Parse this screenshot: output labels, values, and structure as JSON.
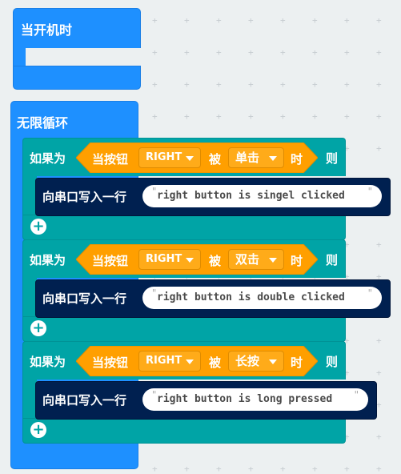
{
  "on_start": {
    "label": "当开机时"
  },
  "forever": {
    "label": "无限循环"
  },
  "if_blocks": [
    {
      "if_label": "如果为",
      "event_prefix": "当按钮",
      "button": "RIGHT",
      "by_label": "被",
      "action": "单击",
      "time_label": "时",
      "then_label": "则",
      "serial_label": "向串口写入一行",
      "message": "right button is singel clicked"
    },
    {
      "if_label": "如果为",
      "event_prefix": "当按钮",
      "button": "RIGHT",
      "by_label": "被",
      "action": "双击",
      "time_label": "时",
      "then_label": "则",
      "serial_label": "向串口写入一行",
      "message": "right button is double clicked"
    },
    {
      "if_label": "如果为",
      "event_prefix": "当按钮",
      "button": "RIGHT",
      "by_label": "被",
      "action": "长按",
      "time_label": "时",
      "then_label": "则",
      "serial_label": "向串口写入一行",
      "message": "right button is long pressed"
    }
  ],
  "quote_char": "\"",
  "plus_symbol": "+",
  "colors": {
    "workspace": "#ecf0f1",
    "basic_blue": "#1e90ff",
    "logic_teal": "#00a4a6",
    "event_orange": "#ff9f00",
    "serial_navy": "#002050"
  }
}
